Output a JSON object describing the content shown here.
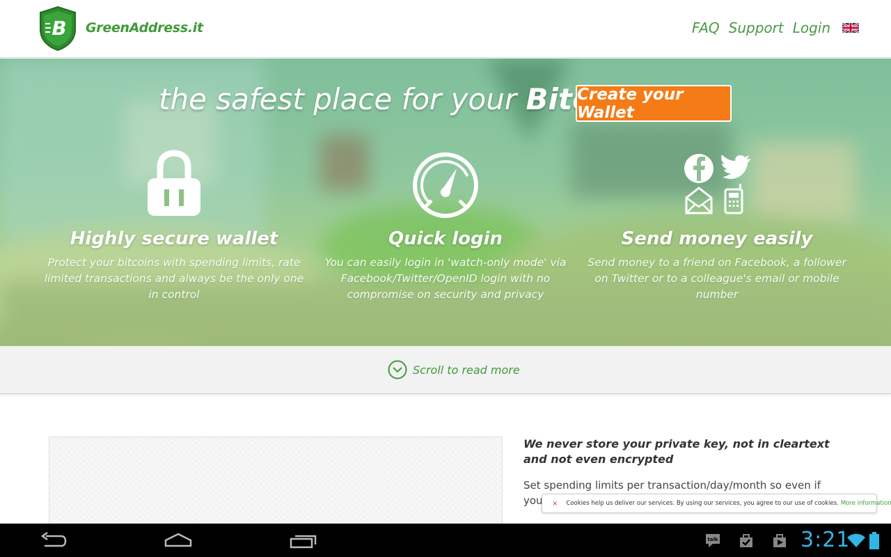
{
  "header": {
    "brand": "GreenAddress.it",
    "nav": [
      "FAQ",
      "Support",
      "Login"
    ],
    "flag_icon": "uk-flag-icon"
  },
  "hero": {
    "tagline_prefix": "the safest place for your ",
    "tagline_bold": "Bitcoins",
    "cta": "Create your Wallet",
    "features": [
      {
        "icon": "padlock-icon",
        "title": "Highly secure wallet",
        "text": "Protect your bitcoins with spending limits, rate limited transactions and always be the only one in control"
      },
      {
        "icon": "speedometer-icon",
        "title": "Quick login",
        "text": "You can easily login in 'watch-only mode' via Facebook/Twitter/OpenID login with no compromise on security and privacy"
      },
      {
        "icon": "social-icons",
        "title": "Send money easily",
        "text": "Send money to a friend on Facebook, a follower on Twitter or to a colleague's email or mobile number"
      }
    ]
  },
  "scroll": {
    "label": "Scroll to read more"
  },
  "content": {
    "heading": "We never store your private key, not in cleartext and not even encrypted",
    "text": "Set spending limits per transaction/day/month so even if your wallet ... balance transaction\""
  },
  "cookie": {
    "text": "Cookies help us deliver our services. By using our services, you agree to our use of cookies.",
    "link": "More information"
  },
  "system": {
    "clock": "3:21"
  },
  "colors": {
    "brand_green": "#3f9b3a",
    "cta_orange": "#f47b16",
    "clock_blue": "#33b5e5"
  }
}
